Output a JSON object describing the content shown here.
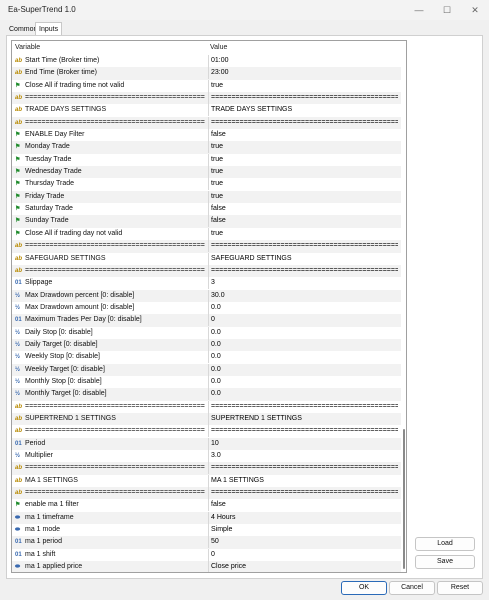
{
  "window": {
    "title": "Ea-SuperTrend 1.0",
    "minimize_glyph": "—",
    "maximize_glyph": "☐",
    "close_glyph": "✕"
  },
  "tabs": [
    {
      "label": "Common",
      "active": false
    },
    {
      "label": "Inputs",
      "active": true
    }
  ],
  "grid": {
    "headers": {
      "variable": "Variable",
      "value": "Value"
    },
    "rows": [
      {
        "icon": "ab",
        "name": "Start Time (Broker time)",
        "value": "01:00"
      },
      {
        "icon": "ab",
        "name": "End Time (Broker time)",
        "value": "23:00"
      },
      {
        "icon": "flag",
        "name": "Close All if trading time not valid",
        "value": "true"
      },
      {
        "icon": "ab",
        "name": "================================================",
        "value": "================================================"
      },
      {
        "icon": "ab",
        "name": "TRADE DAYS SETTINGS",
        "value": "TRADE DAYS SETTINGS"
      },
      {
        "icon": "ab",
        "name": "================================================",
        "value": "================================================"
      },
      {
        "icon": "flag",
        "name": "ENABLE Day Filter",
        "value": "false"
      },
      {
        "icon": "flag",
        "name": "Monday Trade",
        "value": "true"
      },
      {
        "icon": "flag",
        "name": "Tuesday Trade",
        "value": "true"
      },
      {
        "icon": "flag",
        "name": "Wednesday Trade",
        "value": "true"
      },
      {
        "icon": "flag",
        "name": "Thursday Trade",
        "value": "true"
      },
      {
        "icon": "flag",
        "name": "Friday Trade",
        "value": "true"
      },
      {
        "icon": "flag",
        "name": "Saturday Trade",
        "value": "false"
      },
      {
        "icon": "flag",
        "name": "Sunday Trade",
        "value": "false"
      },
      {
        "icon": "flag",
        "name": "Close All if trading day not valid",
        "value": "true"
      },
      {
        "icon": "ab",
        "name": "================================================",
        "value": "================================================"
      },
      {
        "icon": "ab",
        "name": "SAFEGUARD SETTINGS",
        "value": "SAFEGUARD SETTINGS"
      },
      {
        "icon": "ab",
        "name": "================================================",
        "value": "================================================"
      },
      {
        "icon": "num",
        "name": "Slippage",
        "value": "3"
      },
      {
        "icon": "frac",
        "name": "Max Drawdown percent [0: disable]",
        "value": "30.0"
      },
      {
        "icon": "frac",
        "name": "Max Drawdown amount [0: disable]",
        "value": "0.0"
      },
      {
        "icon": "num",
        "name": "Maximum Trades Per Day [0: disable]",
        "value": "0"
      },
      {
        "icon": "frac",
        "name": "Daily Stop [0: disable]",
        "value": "0.0"
      },
      {
        "icon": "frac",
        "name": "Daily Target [0: disable]",
        "value": "0.0"
      },
      {
        "icon": "frac",
        "name": "Weekly Stop [0: disable]",
        "value": "0.0"
      },
      {
        "icon": "frac",
        "name": "Weekly Target [0: disable]",
        "value": "0.0"
      },
      {
        "icon": "frac",
        "name": "Monthly Stop [0: disable]",
        "value": "0.0"
      },
      {
        "icon": "frac",
        "name": "Monthly Target [0: disable]",
        "value": "0.0"
      },
      {
        "icon": "ab",
        "name": "================================================",
        "value": "================================================"
      },
      {
        "icon": "ab",
        "name": "SUPERTREND 1 SETTINGS",
        "value": "SUPERTREND 1 SETTINGS"
      },
      {
        "icon": "ab",
        "name": "================================================",
        "value": "================================================"
      },
      {
        "icon": "num",
        "name": "Period",
        "value": "10"
      },
      {
        "icon": "frac",
        "name": "Multiplier",
        "value": "3.0"
      },
      {
        "icon": "ab",
        "name": "================================================",
        "value": "================================================"
      },
      {
        "icon": "ab",
        "name": "MA 1 SETTINGS",
        "value": "MA 1 SETTINGS"
      },
      {
        "icon": "ab",
        "name": "================================================",
        "value": "================================================"
      },
      {
        "icon": "flag",
        "name": "enable ma 1 filter",
        "value": "false"
      },
      {
        "icon": "list",
        "name": "ma 1 timeframe",
        "value": "4 Hours"
      },
      {
        "icon": "list",
        "name": "ma 1 mode",
        "value": "Simple"
      },
      {
        "icon": "num",
        "name": "ma 1 period",
        "value": "50"
      },
      {
        "icon": "num",
        "name": "ma 1 shift",
        "value": "0"
      },
      {
        "icon": "list",
        "name": "ma 1 applied price",
        "value": "Close price"
      }
    ]
  },
  "icons": {
    "ab": {
      "glyph": "ab",
      "name": "string-param-icon"
    },
    "flag": {
      "glyph": "⚑",
      "name": "bool-param-icon"
    },
    "num": {
      "glyph": "01",
      "name": "int-param-icon"
    },
    "frac": {
      "glyph": "½",
      "name": "double-param-icon"
    },
    "list": {
      "glyph": "⬬",
      "name": "enum-param-icon"
    }
  },
  "side_buttons": {
    "load": "Load",
    "save": "Save"
  },
  "bottom_buttons": {
    "ok": "OK",
    "cancel": "Cancel",
    "reset": "Reset"
  }
}
